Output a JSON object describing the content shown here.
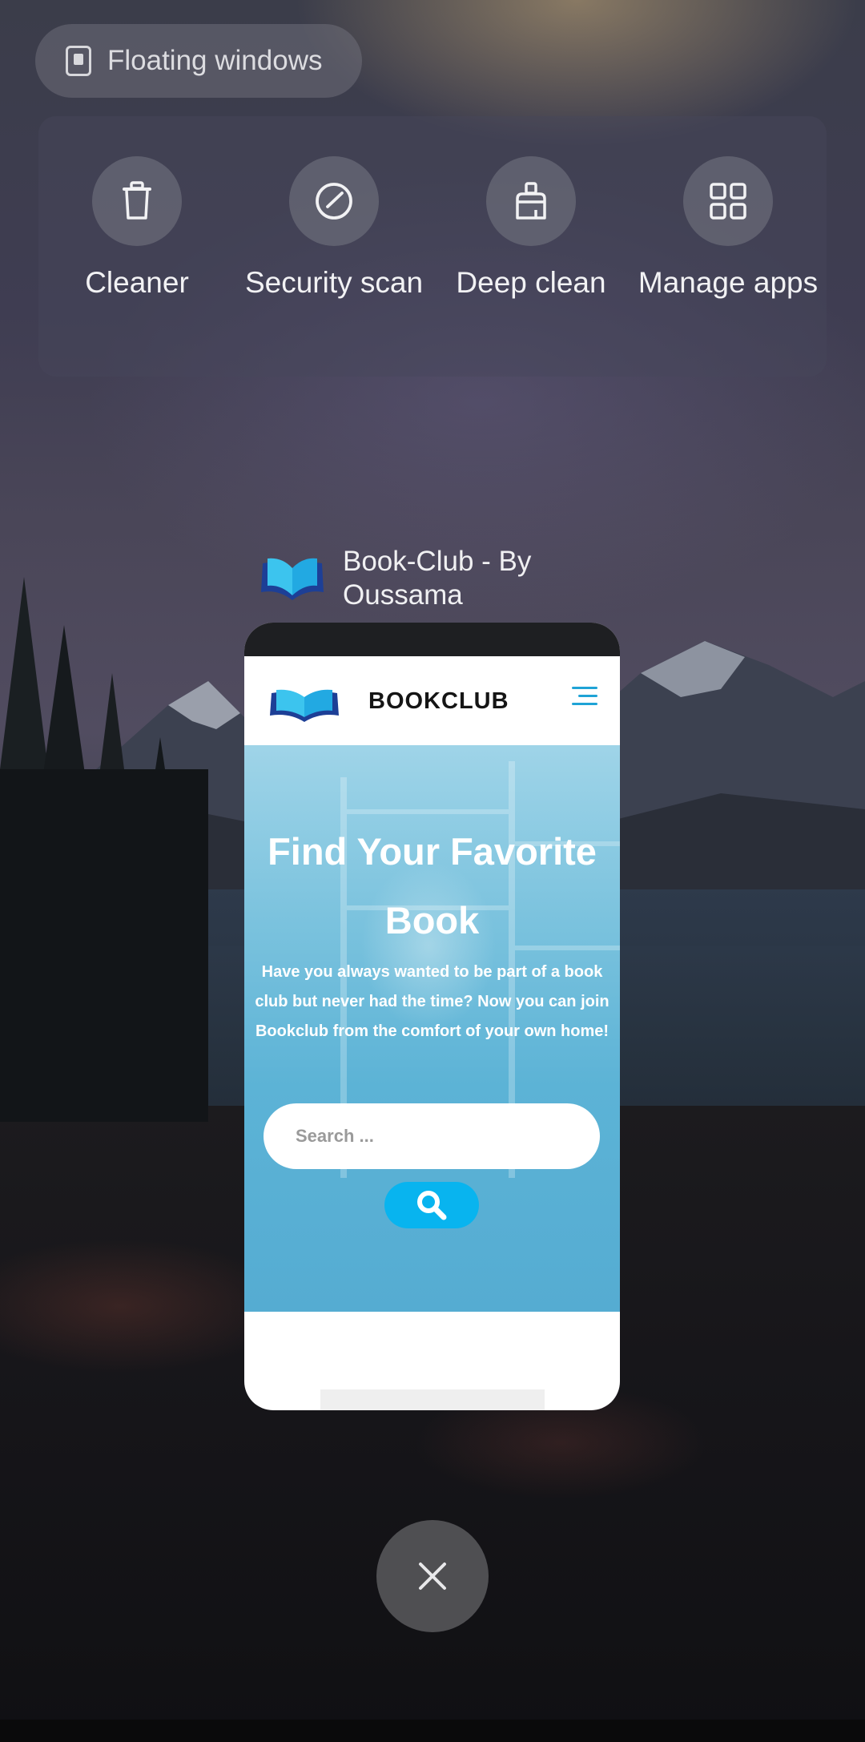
{
  "floating_windows": {
    "label": "Floating windows",
    "icon": "floating-window-icon"
  },
  "tools": [
    {
      "label": "Cleaner",
      "icon": "trash-icon"
    },
    {
      "label": "Security scan",
      "icon": "security-scan-icon"
    },
    {
      "label": "Deep clean",
      "icon": "deep-clean-icon"
    },
    {
      "label": "Manage apps",
      "icon": "grid-apps-icon"
    }
  ],
  "recent_app": {
    "title": "Book-Club - By Oussama",
    "icon": "book-icon",
    "page": {
      "brand": "BOOKCLUB",
      "hero_title": "Find Your Favorite Book",
      "hero_text": "Have you always wanted to be part of a book club but never had the time? Now you can join Bookclub from the comfort of your own home!",
      "search_placeholder": "Search ...",
      "accent_color": "#08b4ef"
    }
  },
  "close": {
    "icon": "close-icon"
  }
}
